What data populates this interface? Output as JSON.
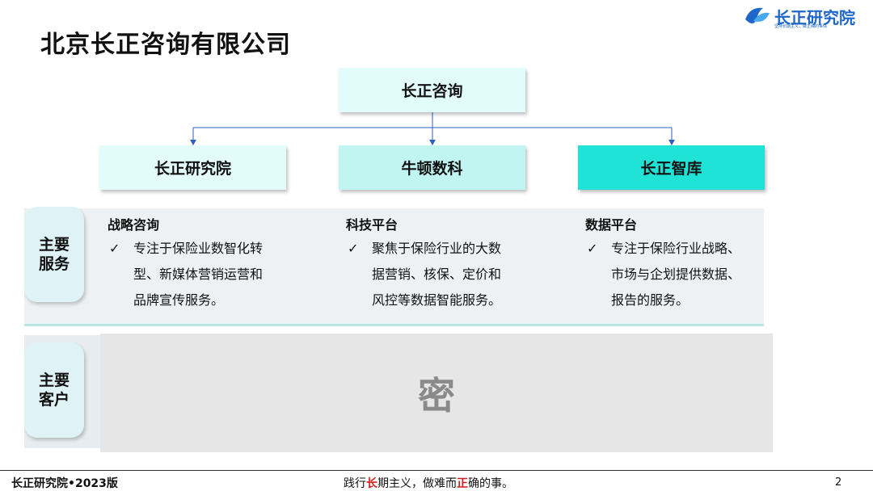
{
  "header": {
    "title": "北京长正咨询有限公司"
  },
  "logo": {
    "name": "长正研究院",
    "tagline": "坚持长期主义，做正确的事情"
  },
  "org": {
    "root": "长正咨询",
    "children": [
      "长正研究院",
      "牛顿数科",
      "长正智库"
    ]
  },
  "rows": {
    "services_label": [
      "主要",
      "服务"
    ],
    "customers_label": [
      "主要",
      "客户"
    ]
  },
  "services": [
    {
      "heading": "战略咨询",
      "lines": [
        "专注于保险业数智化转",
        "型、新媒体营销运营和",
        "品牌宣传服务。"
      ]
    },
    {
      "heading": "科技平台",
      "lines": [
        "聚焦于保险行业的大数",
        "据营销、核保、定价和",
        "风控等数据智能服务。"
      ]
    },
    {
      "heading": "数据平台",
      "lines": [
        "专注于保险行业战略、",
        "市场与企划提供数据、",
        "报告的服务。"
      ]
    }
  ],
  "check_mark": "✓",
  "customers": {
    "redacted_label": "密"
  },
  "footer": {
    "left": "长正研究院•2023版",
    "slogan_parts": [
      "践行",
      "长",
      "期主义，做难而",
      "正",
      "确的事。"
    ],
    "page": "2"
  }
}
